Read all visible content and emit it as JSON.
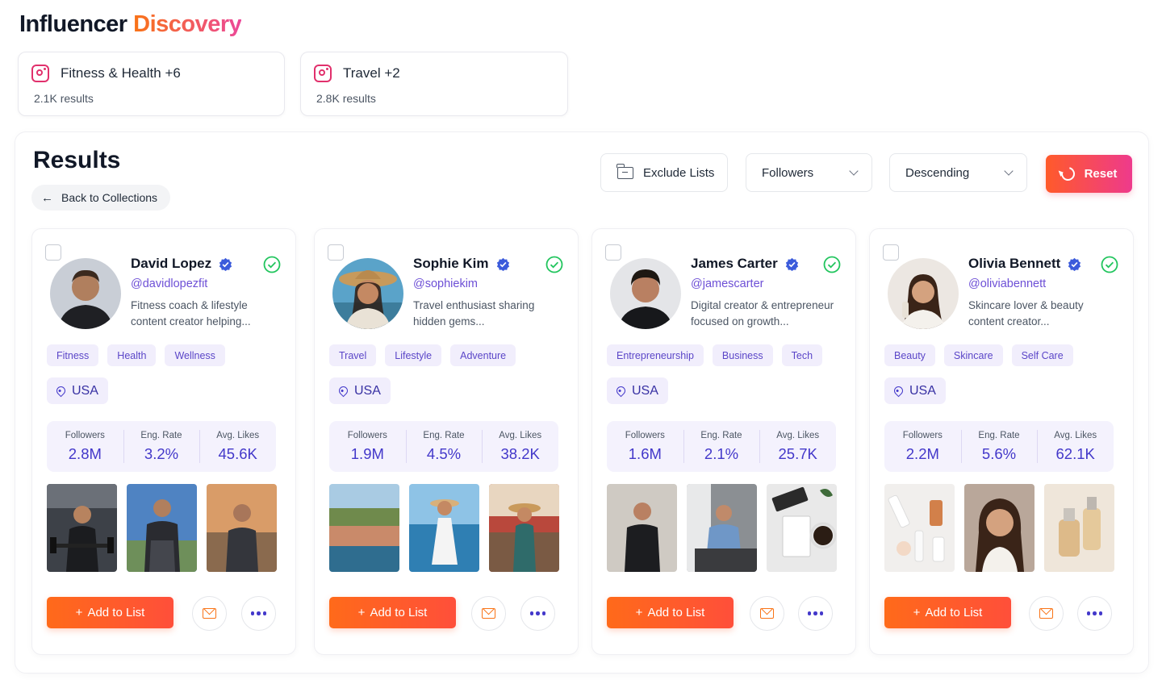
{
  "header": {
    "title_part1": "Influencer",
    "title_part2": "Discovery"
  },
  "saved_searches": [
    {
      "icon": "instagram-icon",
      "label": "Fitness & Health +6",
      "count": "2.1K results"
    },
    {
      "icon": "instagram-icon",
      "label": "Travel +2",
      "count": "2.8K results"
    }
  ],
  "results": {
    "title": "Results",
    "back_label": "Back to Collections",
    "exclude_label": "Exclude Lists",
    "sort_by": "Followers",
    "order": "Descending",
    "reset_label": "Reset"
  },
  "card_labels": {
    "followers": "Followers",
    "eng_rate": "Eng. Rate",
    "avg_likes": "Avg. Likes",
    "add_to_list": "Add to List",
    "add_prefix": "+"
  },
  "influencers": [
    {
      "name": "David Lopez",
      "handle": "@davidlopezfit",
      "bio": "Fitness coach & lifestyle content creator helping...",
      "tags": [
        "Fitness",
        "Health",
        "Wellness"
      ],
      "location": "USA",
      "followers": "2.8M",
      "eng_rate": "3.2%",
      "avg_likes": "45.6K"
    },
    {
      "name": "Sophie Kim",
      "handle": "@sophiekim",
      "bio": "Travel enthusiast sharing hidden gems...",
      "tags": [
        "Travel",
        "Lifestyle",
        "Adventure"
      ],
      "location": "USA",
      "followers": "1.9M",
      "eng_rate": "4.5%",
      "avg_likes": "38.2K"
    },
    {
      "name": "James Carter",
      "handle": "@jamescarter",
      "bio": "Digital creator & entrepreneur focused on growth...",
      "tags": [
        "Entrepreneurship",
        "Business",
        "Tech"
      ],
      "location": "USA",
      "followers": "1.6M",
      "eng_rate": "2.1%",
      "avg_likes": "25.7K"
    },
    {
      "name": "Olivia Bennett",
      "handle": "@oliviabennett",
      "bio": "Skincare lover & beauty content creator...",
      "tags": [
        "Beauty",
        "Skincare",
        "Self Care"
      ],
      "location": "USA",
      "followers": "2.2M",
      "eng_rate": "5.6%",
      "avg_likes": "62.1K"
    }
  ],
  "colors": {
    "accent_purple": "#4338ca",
    "handle_purple": "#6d4fd6",
    "tag_bg": "#f1eefc",
    "cta_orange": "#ff6a1a",
    "reset_gradient_start": "#ff5a2a",
    "reset_gradient_end": "#ee3a8c",
    "verified_blue": "#3b5bdb",
    "status_green": "#22c55e"
  }
}
